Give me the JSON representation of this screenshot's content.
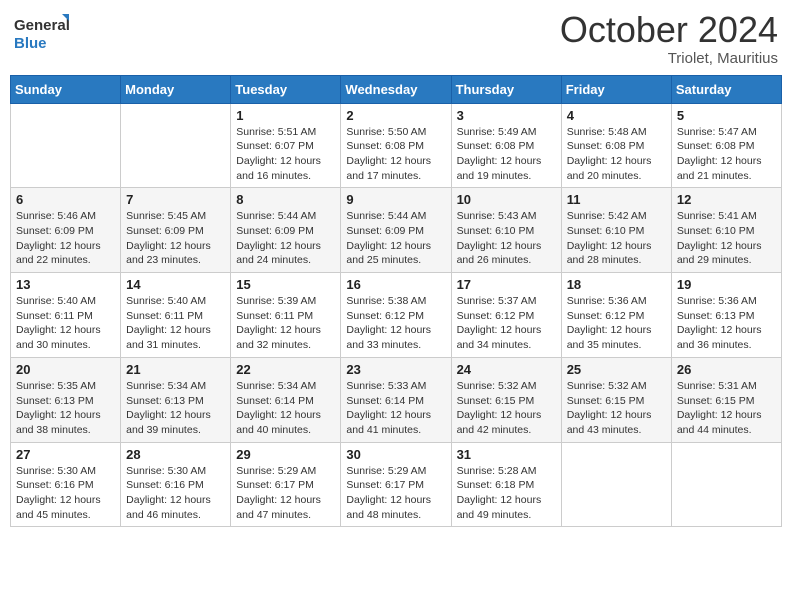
{
  "header": {
    "logo_line1": "General",
    "logo_line2": "Blue",
    "month": "October 2024",
    "location": "Triolet, Mauritius"
  },
  "days_of_week": [
    "Sunday",
    "Monday",
    "Tuesday",
    "Wednesday",
    "Thursday",
    "Friday",
    "Saturday"
  ],
  "weeks": [
    [
      {
        "num": "",
        "info": ""
      },
      {
        "num": "",
        "info": ""
      },
      {
        "num": "1",
        "info": "Sunrise: 5:51 AM\nSunset: 6:07 PM\nDaylight: 12 hours and 16 minutes."
      },
      {
        "num": "2",
        "info": "Sunrise: 5:50 AM\nSunset: 6:08 PM\nDaylight: 12 hours and 17 minutes."
      },
      {
        "num": "3",
        "info": "Sunrise: 5:49 AM\nSunset: 6:08 PM\nDaylight: 12 hours and 19 minutes."
      },
      {
        "num": "4",
        "info": "Sunrise: 5:48 AM\nSunset: 6:08 PM\nDaylight: 12 hours and 20 minutes."
      },
      {
        "num": "5",
        "info": "Sunrise: 5:47 AM\nSunset: 6:08 PM\nDaylight: 12 hours and 21 minutes."
      }
    ],
    [
      {
        "num": "6",
        "info": "Sunrise: 5:46 AM\nSunset: 6:09 PM\nDaylight: 12 hours and 22 minutes."
      },
      {
        "num": "7",
        "info": "Sunrise: 5:45 AM\nSunset: 6:09 PM\nDaylight: 12 hours and 23 minutes."
      },
      {
        "num": "8",
        "info": "Sunrise: 5:44 AM\nSunset: 6:09 PM\nDaylight: 12 hours and 24 minutes."
      },
      {
        "num": "9",
        "info": "Sunrise: 5:44 AM\nSunset: 6:09 PM\nDaylight: 12 hours and 25 minutes."
      },
      {
        "num": "10",
        "info": "Sunrise: 5:43 AM\nSunset: 6:10 PM\nDaylight: 12 hours and 26 minutes."
      },
      {
        "num": "11",
        "info": "Sunrise: 5:42 AM\nSunset: 6:10 PM\nDaylight: 12 hours and 28 minutes."
      },
      {
        "num": "12",
        "info": "Sunrise: 5:41 AM\nSunset: 6:10 PM\nDaylight: 12 hours and 29 minutes."
      }
    ],
    [
      {
        "num": "13",
        "info": "Sunrise: 5:40 AM\nSunset: 6:11 PM\nDaylight: 12 hours and 30 minutes."
      },
      {
        "num": "14",
        "info": "Sunrise: 5:40 AM\nSunset: 6:11 PM\nDaylight: 12 hours and 31 minutes."
      },
      {
        "num": "15",
        "info": "Sunrise: 5:39 AM\nSunset: 6:11 PM\nDaylight: 12 hours and 32 minutes."
      },
      {
        "num": "16",
        "info": "Sunrise: 5:38 AM\nSunset: 6:12 PM\nDaylight: 12 hours and 33 minutes."
      },
      {
        "num": "17",
        "info": "Sunrise: 5:37 AM\nSunset: 6:12 PM\nDaylight: 12 hours and 34 minutes."
      },
      {
        "num": "18",
        "info": "Sunrise: 5:36 AM\nSunset: 6:12 PM\nDaylight: 12 hours and 35 minutes."
      },
      {
        "num": "19",
        "info": "Sunrise: 5:36 AM\nSunset: 6:13 PM\nDaylight: 12 hours and 36 minutes."
      }
    ],
    [
      {
        "num": "20",
        "info": "Sunrise: 5:35 AM\nSunset: 6:13 PM\nDaylight: 12 hours and 38 minutes."
      },
      {
        "num": "21",
        "info": "Sunrise: 5:34 AM\nSunset: 6:13 PM\nDaylight: 12 hours and 39 minutes."
      },
      {
        "num": "22",
        "info": "Sunrise: 5:34 AM\nSunset: 6:14 PM\nDaylight: 12 hours and 40 minutes."
      },
      {
        "num": "23",
        "info": "Sunrise: 5:33 AM\nSunset: 6:14 PM\nDaylight: 12 hours and 41 minutes."
      },
      {
        "num": "24",
        "info": "Sunrise: 5:32 AM\nSunset: 6:15 PM\nDaylight: 12 hours and 42 minutes."
      },
      {
        "num": "25",
        "info": "Sunrise: 5:32 AM\nSunset: 6:15 PM\nDaylight: 12 hours and 43 minutes."
      },
      {
        "num": "26",
        "info": "Sunrise: 5:31 AM\nSunset: 6:15 PM\nDaylight: 12 hours and 44 minutes."
      }
    ],
    [
      {
        "num": "27",
        "info": "Sunrise: 5:30 AM\nSunset: 6:16 PM\nDaylight: 12 hours and 45 minutes."
      },
      {
        "num": "28",
        "info": "Sunrise: 5:30 AM\nSunset: 6:16 PM\nDaylight: 12 hours and 46 minutes."
      },
      {
        "num": "29",
        "info": "Sunrise: 5:29 AM\nSunset: 6:17 PM\nDaylight: 12 hours and 47 minutes."
      },
      {
        "num": "30",
        "info": "Sunrise: 5:29 AM\nSunset: 6:17 PM\nDaylight: 12 hours and 48 minutes."
      },
      {
        "num": "31",
        "info": "Sunrise: 5:28 AM\nSunset: 6:18 PM\nDaylight: 12 hours and 49 minutes."
      },
      {
        "num": "",
        "info": ""
      },
      {
        "num": "",
        "info": ""
      }
    ]
  ]
}
